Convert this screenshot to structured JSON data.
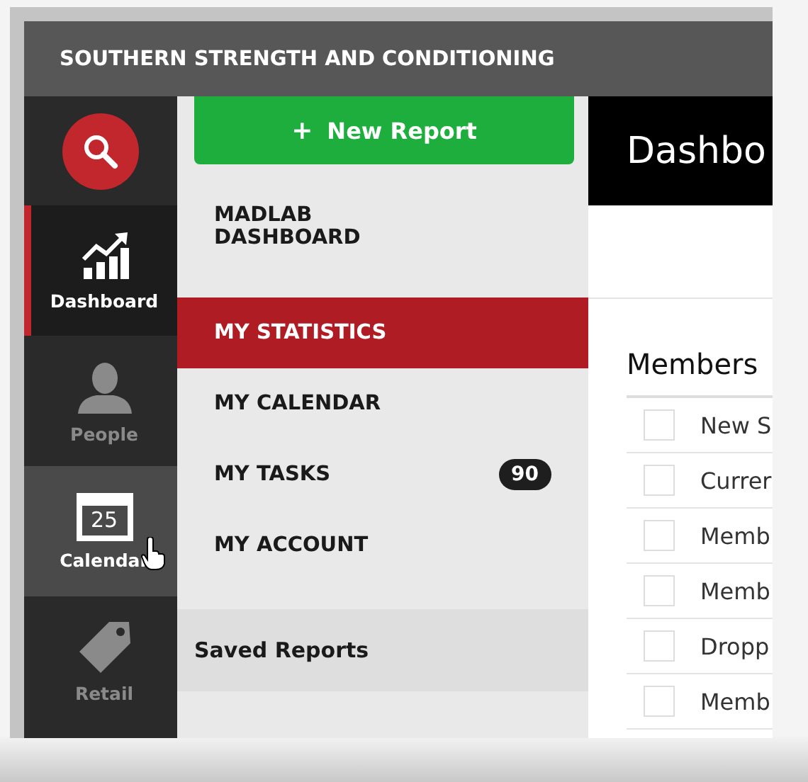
{
  "header": {
    "title": "SOUTHERN STRENGTH AND CONDITIONING"
  },
  "rail": [
    {
      "kind": "search"
    },
    {
      "kind": "dashboard",
      "label": "Dashboard",
      "selected": true,
      "hovered": false
    },
    {
      "kind": "people",
      "label": "People",
      "selected": false,
      "hovered": false
    },
    {
      "kind": "calendar",
      "label": "Calendar",
      "day": "25",
      "selected": false,
      "hovered": true
    },
    {
      "kind": "retail",
      "label": "Retail",
      "selected": false,
      "hovered": false
    }
  ],
  "new_report_button": {
    "icon": "+",
    "label": "New Report"
  },
  "menu": [
    {
      "label": "MADLAB DASHBOARD",
      "selected": false
    },
    {
      "label": "MY STATISTICS",
      "selected": true
    },
    {
      "label": "MY CALENDAR",
      "selected": false
    },
    {
      "label": "MY TASKS",
      "selected": false,
      "badge": "90"
    },
    {
      "label": "MY ACCOUNT",
      "selected": false
    }
  ],
  "saved_reports": {
    "title": "Saved Reports"
  },
  "main": {
    "title": "Dashbo",
    "section_title": "Members",
    "rows": [
      {
        "label": "New S",
        "checked": false
      },
      {
        "label": "Currer",
        "checked": false
      },
      {
        "label": "Memb",
        "checked": false
      },
      {
        "label": "Memb",
        "checked": false
      },
      {
        "label": "Dropp",
        "checked": false
      },
      {
        "label": "Memb",
        "checked": false
      }
    ]
  }
}
